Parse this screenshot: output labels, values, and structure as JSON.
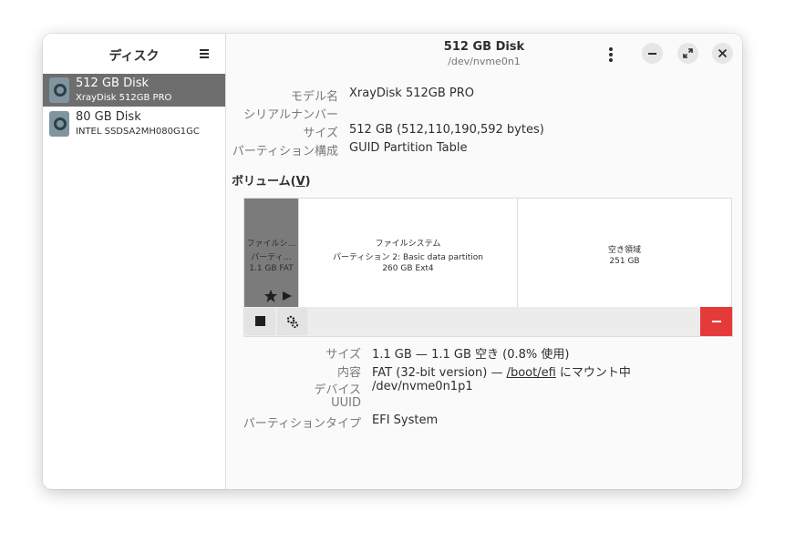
{
  "sidebar": {
    "title": "ディスク",
    "disks": [
      {
        "name": "512 GB Disk",
        "model": "XrayDisk 512GB PRO"
      },
      {
        "name": "80 GB Disk",
        "model": "INTEL SSDSA2MH080G1GC"
      }
    ]
  },
  "header": {
    "title": "512 GB Disk",
    "subtitle": "/dev/nvme0n1"
  },
  "drive": {
    "model_label": "モデル名",
    "model": "XrayDisk 512GB PRO",
    "serial_label": "シリアルナンバー",
    "serial": "",
    "size_label": "サイズ",
    "size": "512 GB (512,110,190,592 bytes)",
    "partitioning_label": "パーティション構成",
    "partitioning": "GUID Partition Table"
  },
  "volumes": {
    "title": "ボリューム(",
    "mnemonic": "V",
    "title_end": ")",
    "partitions": [
      {
        "line1": "ファイルシ…",
        "line2": "パーティ…",
        "line3": "1.1 GB FAT"
      },
      {
        "line1": "ファイルシステム",
        "line2": "パーティション 2: Basic data partition",
        "line3": "260 GB Ext4"
      },
      {
        "line1": "空き領域",
        "line2": "251 GB"
      }
    ]
  },
  "selected": {
    "size_label": "サイズ",
    "size": "1.1 GB — 1.1 GB 空き (0.8% 使用)",
    "contents_label": "内容",
    "contents_pre": "FAT (32-bit version) — ",
    "mount_link": "/boot/efi",
    "contents_post": " にマウント中",
    "device_label": "デバイス",
    "device": "/dev/nvme0n1p1",
    "uuid_label": "UUID",
    "uuid": "",
    "ptype_label": "パーティションタイプ",
    "ptype": "EFI System"
  },
  "colors": {
    "selected_row": "#6e6e6e",
    "destructive": "#e53a3a"
  }
}
